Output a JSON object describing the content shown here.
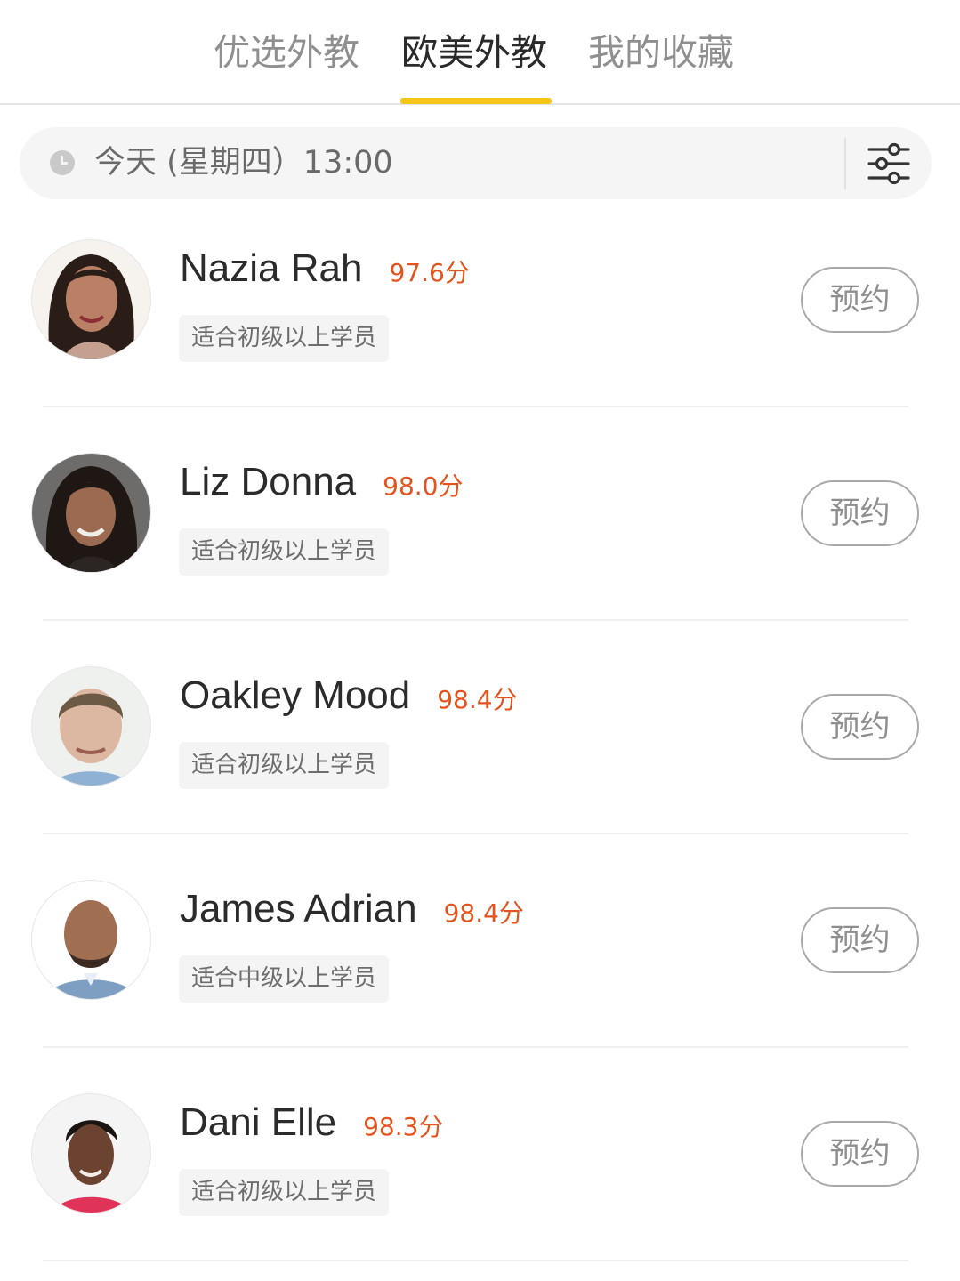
{
  "tabs": [
    {
      "label": "优选外教",
      "active": false
    },
    {
      "label": "欧美外教",
      "active": true
    },
    {
      "label": "我的收藏",
      "active": false
    }
  ],
  "date_filter": {
    "text": "今天 (星期四）13:00",
    "icon": "clock-icon",
    "filter_icon": "sliders-icon"
  },
  "teachers": [
    {
      "name": "Nazia Rah",
      "score": "97.6分",
      "level": "适合初级以上学员",
      "action": "预约"
    },
    {
      "name": "Liz Donna",
      "score": "98.0分",
      "level": "适合初级以上学员",
      "action": "预约"
    },
    {
      "name": "Oakley Mood",
      "score": "98.4分",
      "level": "适合初级以上学员",
      "action": "预约"
    },
    {
      "name": "James Adrian",
      "score": "98.4分",
      "level": "适合中级以上学员",
      "action": "预约"
    },
    {
      "name": "Dani Elle",
      "score": "98.3分",
      "level": "适合初级以上学员",
      "action": "预约"
    }
  ],
  "colors": {
    "accent": "#f5c518",
    "score": "#e4531d",
    "active_tab": "#2a2a2a",
    "inactive_tab": "#8f8f8f"
  }
}
